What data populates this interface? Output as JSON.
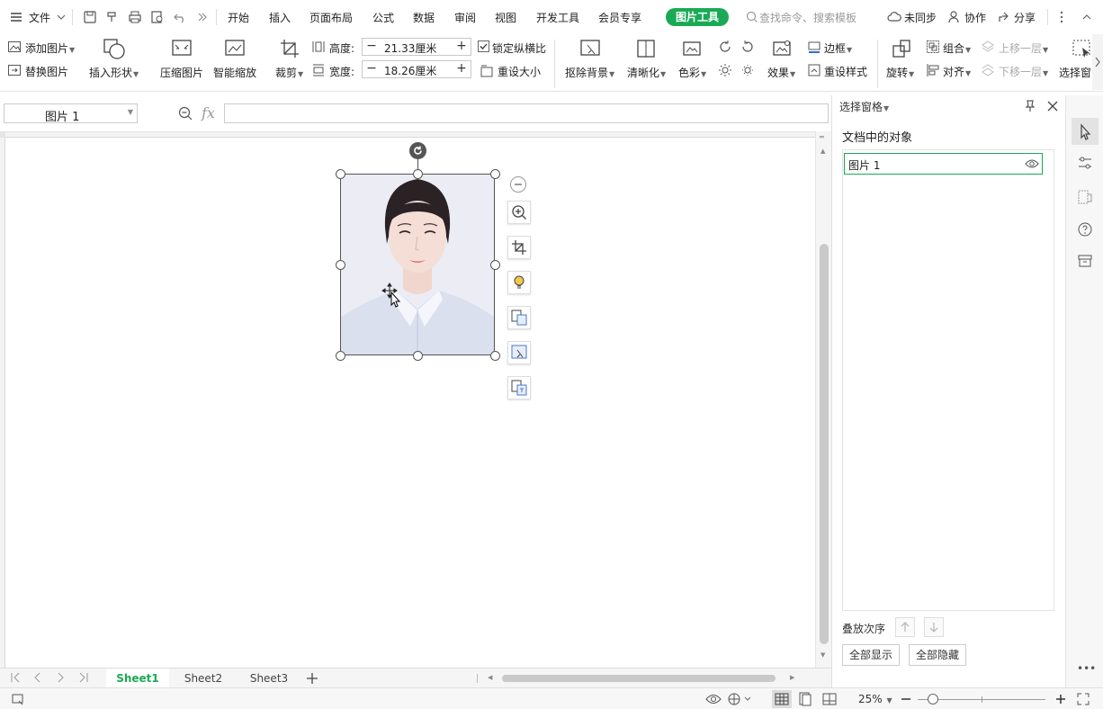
{
  "menubar": {
    "file": "文件",
    "tabs": [
      "开始",
      "插入",
      "页面布局",
      "公式",
      "数据",
      "审阅",
      "视图",
      "开发工具",
      "会员专享"
    ],
    "active_tool_tab": "图片工具",
    "search_placeholder": "查找命令、搜索模板",
    "sync": "未同步",
    "collab": "协作",
    "share": "分享"
  },
  "ribbon": {
    "add_picture": "添加图片",
    "replace_picture": "替换图片",
    "insert_shape": "插入形状",
    "compress_picture": "压缩图片",
    "smart_scale": "智能缩放",
    "crop": "裁剪",
    "height_label": "高度:",
    "height_value": "21.33厘米",
    "width_label": "宽度:",
    "width_value": "18.26厘米",
    "lock_ratio": "锁定纵横比",
    "reset_size": "重设大小",
    "remove_bg": "抠除背景",
    "sharpen": "清晰化",
    "color": "色彩",
    "effects": "效果",
    "border": "边框",
    "reset_style": "重设样式",
    "rotate": "旋转",
    "group": "组合",
    "align": "对齐",
    "bring_forward": "上移一层",
    "send_backward": "下移一层",
    "selection_pane": "选择窗"
  },
  "formulabar": {
    "name_box": "图片 1",
    "fx": "fx",
    "formula": ""
  },
  "sheets": {
    "tabs": [
      "Sheet1",
      "Sheet2",
      "Sheet3"
    ],
    "active": "Sheet1"
  },
  "statusbar": {
    "zoom": "25%"
  },
  "pane": {
    "title": "选择窗格",
    "section": "文档中的对象",
    "objects": [
      {
        "name": "图片 1",
        "visible": true
      }
    ],
    "order_label": "叠放次序",
    "show_all": "全部显示",
    "hide_all": "全部隐藏"
  },
  "colors": {
    "accent": "#1aaa55",
    "selection_border": "#555555"
  }
}
